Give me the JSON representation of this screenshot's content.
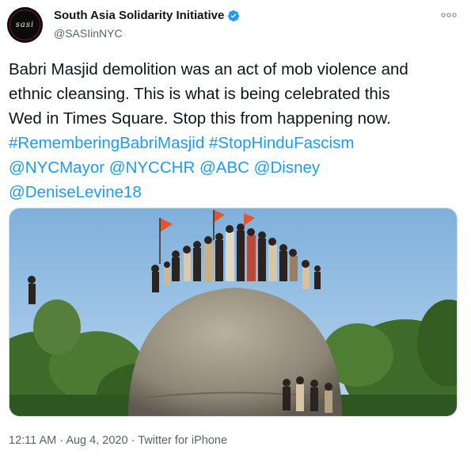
{
  "author": {
    "avatar_text": "sasi",
    "display_name": "South Asia Solidarity Initiative",
    "handle": "@SASIinNYC",
    "verified": true
  },
  "more_icon": "ellipsis-icon",
  "tweet": {
    "text_lines": [
      "Babri Masjid demolition was an act of mob violence and",
      "ethnic cleansing. This is what is being celebrated this",
      "Wed in Times Square. Stop this from happening now."
    ],
    "hashtags": [
      "#RememberingBabriMasjid",
      "#StopHinduFascism"
    ],
    "mentions": [
      "@NYCMayor",
      "@NYCCHR",
      "@ABC",
      "@Disney",
      "@DeniseLevine18"
    ],
    "link_color": "#1d9bf0"
  },
  "media": {
    "kind": "photo"
  },
  "meta": {
    "time": "12:11 AM",
    "date": "Aug 4, 2020",
    "source": "Twitter for iPhone",
    "separator": "·"
  }
}
